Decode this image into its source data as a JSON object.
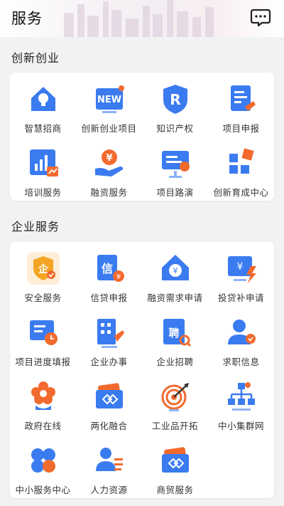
{
  "header": {
    "title": "服务"
  },
  "sections": [
    {
      "title": "创新创业",
      "items": [
        {
          "label": "智慧招商",
          "icon": "smart-investment-icon"
        },
        {
          "label": "创新创业项目",
          "icon": "new-project-icon",
          "badge": "NEW"
        },
        {
          "label": "知识产权",
          "icon": "ip-shield-icon",
          "badge": "R"
        },
        {
          "label": "项目申报",
          "icon": "project-apply-icon"
        },
        {
          "label": "培训服务",
          "icon": "training-chart-icon"
        },
        {
          "label": "融资服务",
          "icon": "financing-hand-icon",
          "badge": "¥"
        },
        {
          "label": "项目路演",
          "icon": "roadshow-icon"
        },
        {
          "label": "创新育成中心",
          "icon": "incubation-blocks-icon"
        }
      ]
    },
    {
      "title": "企业服务",
      "items": [
        {
          "label": "安全服务",
          "icon": "security-shield-icon",
          "badge": "企"
        },
        {
          "label": "信贷申报",
          "icon": "credit-apply-icon",
          "badge": "信"
        },
        {
          "label": "融资需求申请",
          "icon": "financing-house-icon",
          "badge": "¥"
        },
        {
          "label": "投贷补申请",
          "icon": "loan-subsidy-icon",
          "badge": "¥"
        },
        {
          "label": "项目进度填报",
          "icon": "progress-clock-icon"
        },
        {
          "label": "企业办事",
          "icon": "enterprise-affairs-icon"
        },
        {
          "label": "企业招聘",
          "icon": "recruit-icon",
          "badge": "聘"
        },
        {
          "label": "求职信息",
          "icon": "job-seeker-icon"
        },
        {
          "label": "政府在线",
          "icon": "government-flower-icon"
        },
        {
          "label": "两化融合",
          "icon": "integration-icon"
        },
        {
          "label": "工业品开拓",
          "icon": "target-icon"
        },
        {
          "label": "中小集群网",
          "icon": "cluster-network-icon"
        },
        {
          "label": "中小服务中心",
          "icon": "sme-service-icon"
        },
        {
          "label": "人力资源",
          "icon": "human-resources-icon"
        },
        {
          "label": "商贸服务",
          "icon": "trade-service-icon"
        }
      ]
    }
  ],
  "colors": {
    "blue": "#3a7bf0",
    "orange": "#f26a2e",
    "background": "#f1f2f4"
  }
}
